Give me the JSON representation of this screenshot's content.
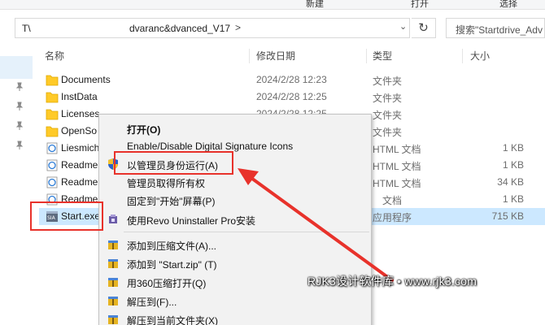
{
  "ribbon": {
    "items": [
      "",
      "新建",
      "打开",
      "选择"
    ]
  },
  "address": {
    "prefix": "T\\",
    "path": "dvaranc&dvanced_V17",
    "chevron": ">",
    "dropdown": "⌄",
    "refresh_icon": "↻"
  },
  "search": {
    "placeholder": "搜索\"Startdrive_Adv"
  },
  "columns": {
    "name": "名称",
    "date": "修改日期",
    "type": "类型",
    "size": "大小"
  },
  "files": [
    {
      "name": "Documents",
      "date": "2024/2/28 12:23",
      "type": "文件夹",
      "size": "",
      "icon": "folder-icon"
    },
    {
      "name": "InstData",
      "date": "2024/2/28 12:25",
      "type": "文件夹",
      "size": "",
      "icon": "folder-icon"
    },
    {
      "name": "Licenses",
      "date": "2024/2/28 12:25",
      "type": "文件夹",
      "size": "",
      "icon": "folder-icon"
    },
    {
      "name": "OpenSo",
      "date": "",
      "type": "文件夹",
      "size": "",
      "icon": "folder-icon"
    },
    {
      "name": "Liesmich",
      "date": "",
      "type": "HTML 文档",
      "size": "1 KB",
      "icon": "html-file-icon"
    },
    {
      "name": "Readme",
      "date": "",
      "type": "HTML 文档",
      "size": "1 KB",
      "icon": "html-file-icon"
    },
    {
      "name": "Readme",
      "date": "",
      "type": "HTML 文档",
      "size": "34 KB",
      "icon": "html-file-icon"
    },
    {
      "name": "Readme",
      "date": "",
      "type": "文档",
      "size": "1 KB",
      "icon": "html-file-icon"
    },
    {
      "name": "Start.exe",
      "date": "",
      "type": "应用程序",
      "size": "715 KB",
      "icon": "app-icon"
    }
  ],
  "context_menu": {
    "items": [
      {
        "label": "打开(O)",
        "icon": ""
      },
      {
        "label": "Enable/Disable Digital Signature Icons",
        "icon": ""
      },
      {
        "label": "以管理员身份运行(A)",
        "icon": "uac-shield-icon"
      },
      {
        "label": "管理员取得所有权",
        "icon": ""
      },
      {
        "label": "固定到\"开始\"屏幕(P)",
        "icon": ""
      },
      {
        "label": "使用Revo Uninstaller Pro安装",
        "icon": "revo-icon"
      },
      {
        "label": "添加到压缩文件(A)...",
        "icon": "archive-icon"
      },
      {
        "label": "添加到 \"Start.zip\" (T)",
        "icon": "archive-icon"
      },
      {
        "label": "用360压缩打开(Q)",
        "icon": "archive-icon"
      },
      {
        "label": "解压到(F)...",
        "icon": "archive-icon"
      },
      {
        "label": "解压到当前文件夹(X)",
        "icon": "archive-icon"
      }
    ]
  },
  "watermark": "RJK3设计软件库 • www.rjk3.com",
  "colors": {
    "selection": "#cce8ff",
    "annotation": "#e8322b",
    "folder": "#ffca28",
    "menu_bg": "#f2f2f2"
  }
}
